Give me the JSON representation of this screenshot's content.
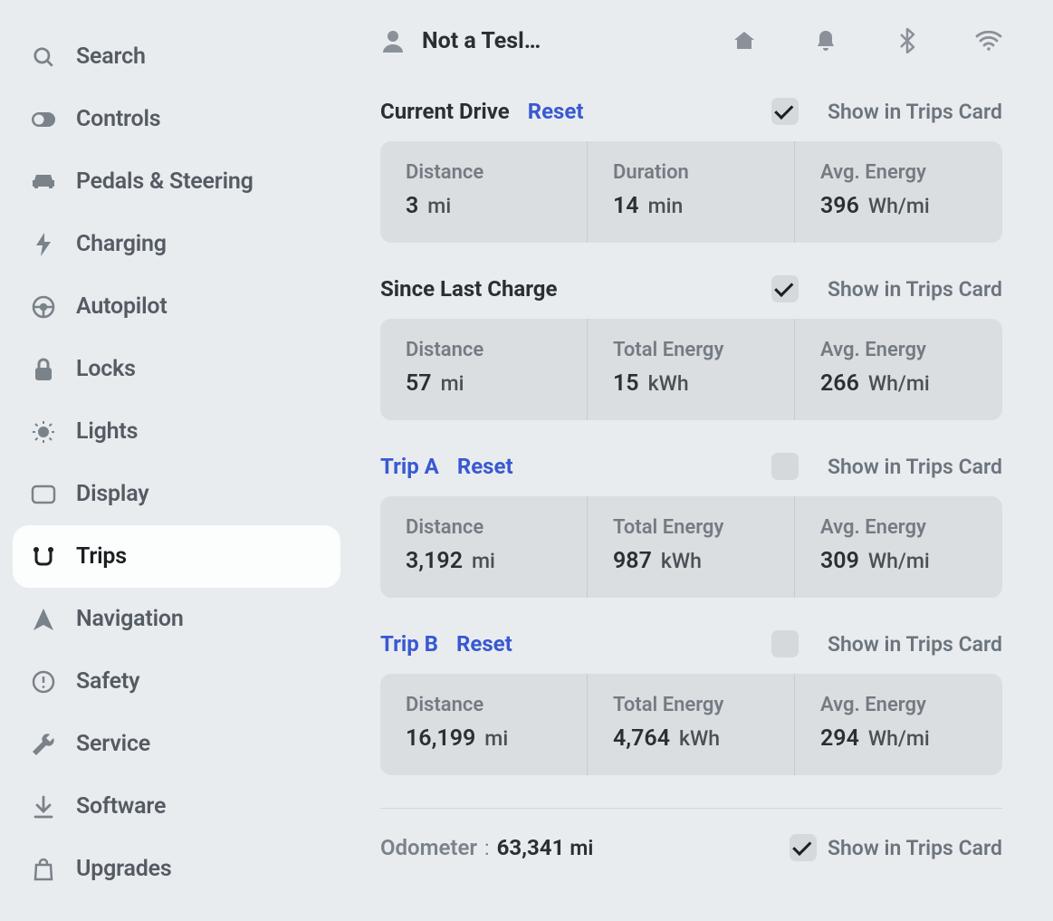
{
  "sidebar": {
    "items": [
      {
        "label": "Search"
      },
      {
        "label": "Controls"
      },
      {
        "label": "Pedals & Steering"
      },
      {
        "label": "Charging"
      },
      {
        "label": "Autopilot"
      },
      {
        "label": "Locks"
      },
      {
        "label": "Lights"
      },
      {
        "label": "Display"
      },
      {
        "label": "Trips"
      },
      {
        "label": "Navigation"
      },
      {
        "label": "Safety"
      },
      {
        "label": "Service"
      },
      {
        "label": "Software"
      },
      {
        "label": "Upgrades"
      }
    ]
  },
  "topbar": {
    "profile_name": "Not a Tesla App"
  },
  "labels": {
    "reset": "Reset",
    "show_in_trips_card": "Show in Trips Card",
    "distance": "Distance",
    "duration": "Duration",
    "total_energy": "Total Energy",
    "avg_energy": "Avg. Energy",
    "odometer": "Odometer"
  },
  "units": {
    "mi": "mi",
    "min": "min",
    "kwh": "kWh",
    "whmi": "Wh/mi"
  },
  "sections": {
    "current_drive": {
      "title": "Current Drive",
      "distance": "3",
      "duration": "14",
      "avg_energy": "396"
    },
    "since_last_charge": {
      "title": "Since Last Charge",
      "distance": "57",
      "total_energy": "15",
      "avg_energy": "266"
    },
    "trip_a": {
      "title": "Trip A",
      "distance": "3,192",
      "total_energy": "987",
      "avg_energy": "309"
    },
    "trip_b": {
      "title": "Trip B",
      "distance": "16,199",
      "total_energy": "4,764",
      "avg_energy": "294"
    }
  },
  "odometer": {
    "value": "63,341"
  }
}
